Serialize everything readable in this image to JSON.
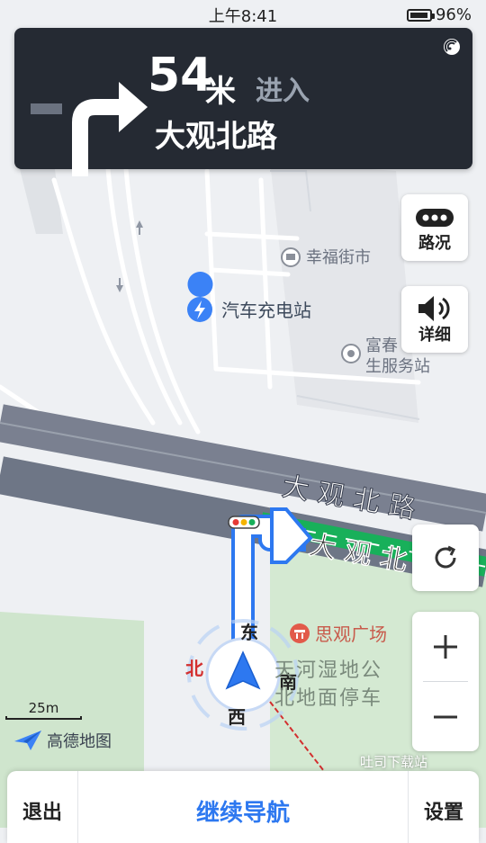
{
  "status_bar": {
    "time": "上午8:41",
    "battery": "96%",
    "battery_level": 0.96
  },
  "guidance": {
    "distance": "54",
    "unit": "米",
    "action": "进入",
    "road": "大观北路",
    "turn_icon": "turn-right-arrow-icon"
  },
  "side_buttons": {
    "traffic": {
      "label": "路况",
      "icon": "traffic-dots-icon"
    },
    "detail": {
      "label": "详细",
      "icon": "speaker-icon"
    }
  },
  "map": {
    "pois": [
      {
        "name": "幸福街市",
        "icon": "market-icon"
      },
      {
        "name": "汽车充电站",
        "icon": "charging-station-icon"
      },
      {
        "name": "富春生服务站",
        "line1": "富春",
        "line2": "生服务站",
        "icon": "service-station-icon"
      },
      {
        "name": "思观广场",
        "icon": "plaza-icon"
      },
      {
        "name": "天河湿地公园北地面停车场",
        "line1": "天河湿地公",
        "line2": "北地面停车",
        "icon": "parking-icon"
      }
    ],
    "road_label": "大观北路",
    "route_road_label": "大观北",
    "compass": {
      "east": "东",
      "south": "南",
      "west": "西",
      "north": "北"
    },
    "scale": "25m",
    "logo": "高德地图",
    "watermark": "吐司下载站",
    "colors": {
      "route": "#2d78f0",
      "traffic_clear": "#18b05a",
      "road": "#6e7686"
    }
  },
  "bottom_bar": {
    "exit": "退出",
    "continue": "继续导航",
    "settings": "设置"
  }
}
